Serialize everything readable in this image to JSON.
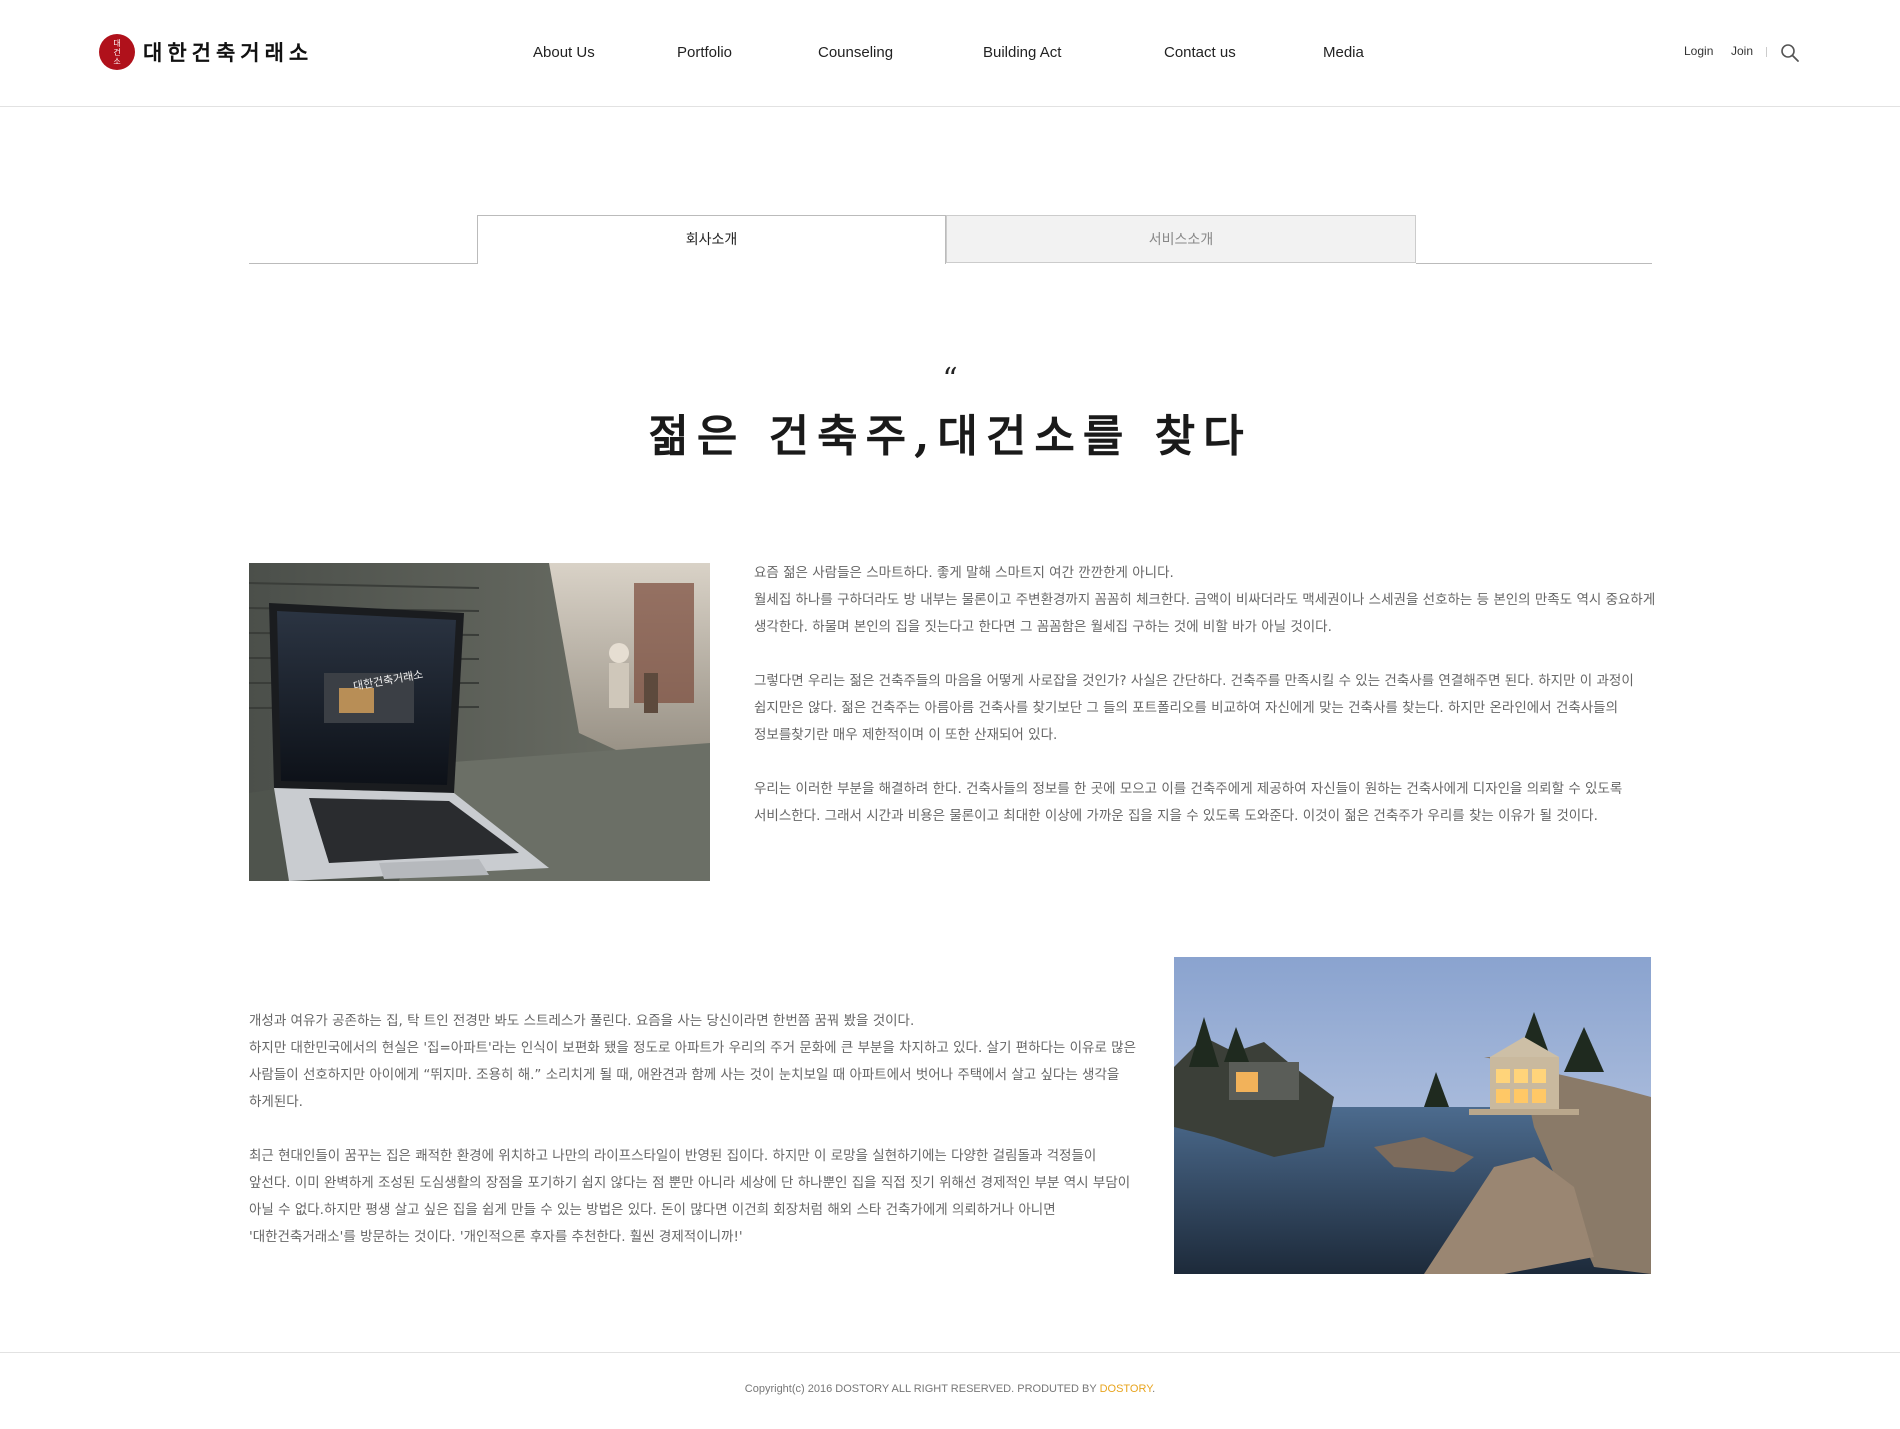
{
  "header": {
    "logo_seal": [
      "대",
      "건",
      "소"
    ],
    "logo_text": "대한건축거래소",
    "nav": [
      "About Us",
      "Portfolio",
      "Counseling",
      "Building Act",
      "Contact us",
      "Media"
    ],
    "login_label": "Login",
    "join_label": "Join",
    "search_icon": "search-icon"
  },
  "tabs": {
    "active": "회사소개",
    "inactive": "서비스소개"
  },
  "heading": {
    "quote": "“",
    "title": "젊은 건축주,대건소를 찾다"
  },
  "section1": {
    "image_icon": "laptop-photo",
    "laptop_screen_text": "대한건축거래소",
    "paragraphs": [
      "요즘 젊은 사람들은 스마트하다. 좋게 말해 스마트지 여간 깐깐한게 아니다.\n월세집 하나를 구하더라도 방 내부는 물론이고 주변환경까지 꼼꼼히 체크한다. 금액이 비싸더라도 맥세권이나 스세권을 선호하는 등 본인의 만족도 역시 중요하게 생각한다. 하물며 본인의 집을 짓는다고 한다면 그 꼼꼼함은 월세집 구하는 것에 비할 바가 아닐 것이다.",
      "그렇다면 우리는 젊은 건축주들의 마음을 어떻게 사로잡을 것인가? 사실은 간단하다. 건축주를 만족시킬 수 있는 건축사를 연결해주면 된다. 하지만 이 과정이 쉽지만은 않다. 젊은 건축주는 아름아름 건축사를 찾기보단 그 들의 포트폴리오를 비교하여 자신에게 맞는 건축사를 찾는다. 하지만 온라인에서 건축사들의 정보를찾기란 매우 제한적이며 이 또한 산재되어 있다.",
      "우리는 이러한 부분을 해결하려 한다. 건축사들의 정보를 한 곳에 모으고 이를 건축주에게 제공하여 자신들이 원하는 건축사에게 디자인을 의뢰할 수 있도록 서비스한다. 그래서 시간과 비용은 물론이고 최대한 이상에 가까운 집을 지을 수 있도록 도와준다. 이것이 젊은 건축주가 우리를 찾는 이유가 될 것이다."
    ]
  },
  "section2": {
    "image_icon": "lake-house-photo",
    "paragraphs": [
      "개성과 여유가 공존하는 집, 탁 트인 전경만 봐도 스트레스가 풀린다. 요즘을 사는 당신이라면 한번쯤 꿈꿔 봤을 것이다.\n하지만 대한민국에서의 현실은 '집=아파트'라는 인식이 보편화 됐을 정도로 아파트가 우리의 주거 문화에 큰 부분을 차지하고 있다. 살기 편하다는 이유로 많은 사람들이 선호하지만 아이에게 “뛰지마. 조용히 해.” 소리치게 될 때, 애완견과 함께 사는 것이 눈치보일 때 아파트에서 벗어나 주택에서 살고 싶다는 생각을 하게된다.",
      "최근 현대인들이 꿈꾸는 집은 쾌적한 환경에 위치하고 나만의 라이프스타일이 반영된 집이다. 하지만 이 로망을 실현하기에는 다양한 걸림돌과 걱정들이 앞선다. 이미 완벽하게 조성된 도심생활의 장점을 포기하기 쉽지 않다는 점 뿐만 아니라 세상에 단 하나뿐인 집을 직접 짓기 위해선 경제적인 부분 역시 부담이 아닐 수 없다.하지만 평생 살고 싶은 집을 쉽게 만들 수 있는 방법은 있다. 돈이 많다면 이건희 회장처럼 해외 스타 건축가에게 의뢰하거나 아니면 '대한건축거래소'를 방문하는 것이다. '개인적으론 후자를 추천한다. 훨씬 경제적이니까!'"
    ]
  },
  "footer": {
    "copyright": "Copyright(c) 2016 DOSTORY ALL RIGHT RESERVED. PRODUTED BY ",
    "brand": "DOSTORY",
    "period": ".",
    "brand_color": "#e8a41e"
  },
  "colors": {
    "seal_red": "#b0111b",
    "text_gray": "#666666",
    "tab_inactive_bg": "#f2f2f2"
  }
}
